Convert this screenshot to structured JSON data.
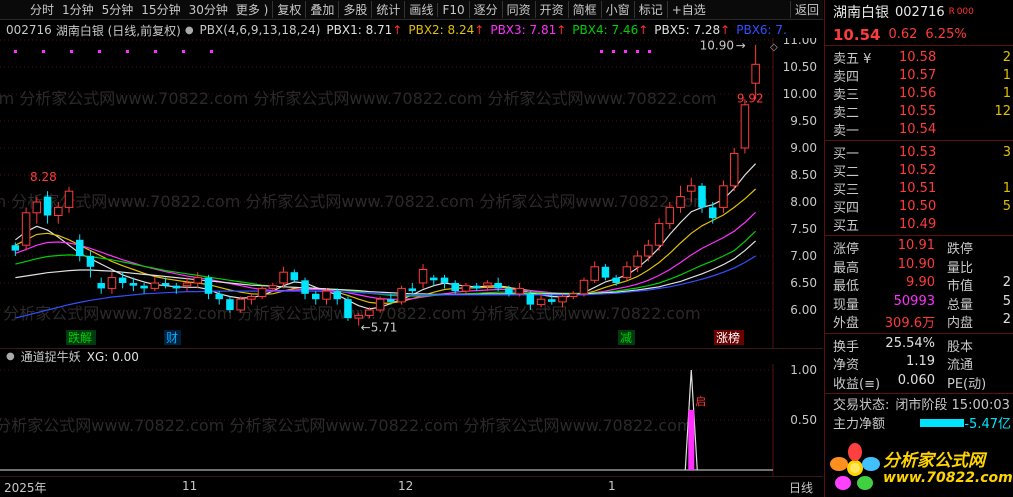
{
  "toolbar": {
    "periods": [
      "分时",
      "1分钟",
      "5分钟",
      "15分钟",
      "30分钟",
      "更多 )"
    ],
    "tools": [
      "复权",
      "叠加",
      "多股",
      "统计",
      "画线",
      "F10",
      "逐分",
      "同资",
      "开资",
      "简框",
      "小窗",
      "标记",
      "+自选",
      "返回"
    ]
  },
  "infobar": {
    "code": "002716",
    "name": "湖南白银 (日线,前复权)",
    "param": "PBX(4,6,9,13,18,24)",
    "pbx": [
      {
        "label": "PBX1: 8.71",
        "color": "#e0e0e0"
      },
      {
        "label": "PBX2: 8.24",
        "color": "#e0c000"
      },
      {
        "label": "PBX3: 7.81",
        "color": "#ff30ff"
      },
      {
        "label": "PBX4: 7.46",
        "color": "#00d000"
      },
      {
        "label": "PBX5: 7.28",
        "color": "#e0e0e0"
      },
      {
        "label": "PBX6: 7.",
        "color": "#3050ff"
      }
    ],
    "up_arrow": "↑"
  },
  "indicator": {
    "title": "通道捉牛妖",
    "xg": "XG: 0.00",
    "ticks": [
      "1.00",
      "0.50"
    ],
    "signal_label": "启"
  },
  "markers": {
    "high_label": "8.28",
    "low_label": "←5.71",
    "top_label": "10.90",
    "top_arrow": "→",
    "last_label": "9.92",
    "events": [
      "跌解",
      "财",
      "减",
      "涨榜"
    ]
  },
  "xaxis": {
    "labels": [
      "2025年",
      "11",
      "12",
      "1",
      "日线"
    ]
  },
  "colors": {
    "up": "#ff3b3b",
    "down": "#00e5ff",
    "bg": "#000000",
    "grid": "#4a1010"
  },
  "chart_data": {
    "type": "candlestick",
    "y_ticks": [
      "11.00",
      "10.50",
      "10.00",
      "9.50",
      "9.00",
      "8.50",
      "8.00",
      "7.50",
      "7.00",
      "6.50",
      "6.00"
    ],
    "ylim": [
      5.5,
      11.2
    ],
    "candles": [
      [
        7.2,
        7.1,
        7.25,
        7.0
      ],
      [
        7.2,
        7.8,
        7.9,
        7.1
      ],
      [
        7.8,
        8.0,
        8.1,
        7.6
      ],
      [
        8.1,
        7.75,
        8.2,
        7.6
      ],
      [
        7.75,
        7.9,
        8.0,
        7.6
      ],
      [
        7.9,
        8.2,
        8.28,
        7.8
      ],
      [
        7.3,
        7.0,
        7.4,
        6.9
      ],
      [
        7.0,
        6.8,
        7.1,
        6.6
      ],
      [
        6.5,
        6.4,
        6.6,
        6.3
      ],
      [
        6.4,
        6.6,
        6.7,
        6.3
      ],
      [
        6.6,
        6.5,
        6.7,
        6.4
      ],
      [
        6.5,
        6.45,
        6.6,
        6.35
      ],
      [
        6.45,
        6.4,
        6.5,
        6.3
      ],
      [
        6.4,
        6.5,
        6.6,
        6.35
      ],
      [
        6.5,
        6.45,
        6.6,
        6.4
      ],
      [
        6.45,
        6.4,
        6.5,
        6.3
      ],
      [
        6.45,
        6.5,
        6.6,
        6.35
      ],
      [
        6.5,
        6.6,
        6.7,
        6.4
      ],
      [
        6.6,
        6.3,
        6.65,
        6.2
      ],
      [
        6.3,
        6.2,
        6.35,
        6.1
      ],
      [
        6.2,
        6.0,
        6.25,
        5.95
      ],
      [
        6.0,
        6.2,
        6.25,
        5.95
      ],
      [
        6.2,
        6.25,
        6.3,
        6.1
      ],
      [
        6.25,
        6.4,
        6.45,
        6.2
      ],
      [
        6.4,
        6.45,
        6.5,
        6.35
      ],
      [
        6.5,
        6.7,
        6.8,
        6.4
      ],
      [
        6.7,
        6.55,
        6.75,
        6.5
      ],
      [
        6.55,
        6.3,
        6.6,
        6.2
      ],
      [
        6.3,
        6.2,
        6.35,
        6.1
      ],
      [
        6.2,
        6.35,
        6.4,
        6.1
      ],
      [
        6.35,
        6.2,
        6.4,
        6.1
      ],
      [
        6.2,
        5.85,
        6.25,
        5.8
      ],
      [
        5.85,
        5.9,
        5.95,
        5.71
      ],
      [
        5.9,
        6.0,
        6.05,
        5.85
      ],
      [
        6.0,
        6.2,
        6.25,
        5.95
      ],
      [
        6.2,
        6.15,
        6.3,
        6.1
      ],
      [
        6.15,
        6.4,
        6.45,
        6.1
      ],
      [
        6.4,
        6.35,
        6.5,
        6.3
      ],
      [
        6.5,
        6.75,
        6.85,
        6.4
      ],
      [
        6.6,
        6.55,
        6.65,
        6.45
      ],
      [
        6.6,
        6.5,
        6.65,
        6.4
      ],
      [
        6.5,
        6.35,
        6.55,
        6.3
      ],
      [
        6.35,
        6.45,
        6.5,
        6.3
      ],
      [
        6.45,
        6.4,
        6.5,
        6.35
      ],
      [
        6.45,
        6.5,
        6.55,
        6.35
      ],
      [
        6.5,
        6.4,
        6.6,
        6.35
      ],
      [
        6.4,
        6.3,
        6.45,
        6.25
      ],
      [
        6.3,
        6.4,
        6.5,
        6.25
      ],
      [
        6.3,
        6.1,
        6.35,
        6.0
      ],
      [
        6.1,
        6.2,
        6.3,
        6.05
      ],
      [
        6.2,
        6.15,
        6.3,
        6.1
      ],
      [
        6.15,
        6.25,
        6.3,
        6.05
      ],
      [
        6.25,
        6.3,
        6.35,
        6.2
      ],
      [
        6.3,
        6.55,
        6.6,
        6.25
      ],
      [
        6.55,
        6.8,
        6.9,
        6.5
      ],
      [
        6.8,
        6.6,
        6.85,
        6.55
      ],
      [
        6.6,
        6.5,
        6.65,
        6.45
      ],
      [
        6.6,
        6.8,
        6.9,
        6.55
      ],
      [
        6.8,
        7.0,
        7.1,
        6.7
      ],
      [
        7.0,
        7.2,
        7.3,
        6.9
      ],
      [
        7.2,
        7.6,
        7.7,
        7.1
      ],
      [
        7.6,
        7.9,
        8.0,
        7.5
      ],
      [
        7.9,
        8.1,
        8.3,
        7.8
      ],
      [
        8.2,
        8.3,
        8.45,
        8.0
      ],
      [
        8.3,
        7.9,
        8.35,
        7.8
      ],
      [
        7.9,
        7.7,
        8.0,
        7.6
      ],
      [
        7.9,
        8.3,
        8.4,
        7.8
      ],
      [
        8.3,
        8.9,
        9.0,
        8.2
      ],
      [
        9.0,
        9.8,
        9.9,
        8.9
      ],
      [
        10.2,
        10.55,
        10.91,
        9.9
      ]
    ],
    "ma_series": [
      {
        "color": "#e0e0e0",
        "values": [
          7.3,
          7.45,
          7.55,
          7.48,
          7.35,
          7.2,
          7.05,
          6.95,
          6.85,
          6.75,
          6.65,
          6.58,
          6.52,
          6.47,
          6.45,
          6.43,
          6.42,
          6.42,
          6.38,
          6.3,
          6.25,
          6.22,
          6.23,
          6.27,
          6.35,
          6.45,
          6.52,
          6.5,
          6.42,
          6.35,
          6.28,
          6.18,
          6.08,
          6.02,
          6.05,
          6.12,
          6.2,
          6.28,
          6.38,
          6.45,
          6.5,
          6.47,
          6.44,
          6.43,
          6.44,
          6.45,
          6.42,
          6.38,
          6.32,
          6.28,
          6.25,
          6.24,
          6.26,
          6.32,
          6.42,
          6.52,
          6.58,
          6.65,
          6.78,
          6.95,
          7.15,
          7.4,
          7.62,
          7.82,
          7.9,
          7.95,
          8.05,
          8.25,
          8.5,
          8.71
        ]
      },
      {
        "color": "#e0c000",
        "values": [
          7.2,
          7.3,
          7.4,
          7.42,
          7.38,
          7.3,
          7.2,
          7.1,
          7.0,
          6.9,
          6.82,
          6.75,
          6.68,
          6.62,
          6.58,
          6.55,
          6.52,
          6.5,
          6.47,
          6.42,
          6.37,
          6.33,
          6.3,
          6.29,
          6.3,
          6.35,
          6.4,
          6.42,
          6.4,
          6.37,
          6.33,
          6.27,
          6.2,
          6.14,
          6.12,
          6.13,
          6.16,
          6.21,
          6.27,
          6.33,
          6.38,
          6.4,
          6.41,
          6.41,
          6.42,
          6.42,
          6.41,
          6.39,
          6.36,
          6.33,
          6.3,
          6.28,
          6.28,
          6.3,
          6.35,
          6.42,
          6.48,
          6.54,
          6.62,
          6.74,
          6.88,
          7.05,
          7.24,
          7.42,
          7.56,
          7.66,
          7.76,
          7.9,
          8.06,
          8.24
        ]
      },
      {
        "color": "#ff30ff",
        "values": [
          7.05,
          7.12,
          7.2,
          7.25,
          7.26,
          7.24,
          7.2,
          7.14,
          7.07,
          7.0,
          6.93,
          6.87,
          6.81,
          6.76,
          6.71,
          6.67,
          6.63,
          6.6,
          6.57,
          6.53,
          6.49,
          6.45,
          6.41,
          6.38,
          6.36,
          6.36,
          6.37,
          6.38,
          6.38,
          6.37,
          6.35,
          6.32,
          6.28,
          6.24,
          6.21,
          6.2,
          6.2,
          6.21,
          6.24,
          6.27,
          6.3,
          6.33,
          6.35,
          6.36,
          6.37,
          6.38,
          6.38,
          6.37,
          6.36,
          6.34,
          6.32,
          6.31,
          6.3,
          6.3,
          6.32,
          6.35,
          6.39,
          6.43,
          6.48,
          6.55,
          6.64,
          6.75,
          6.88,
          7.02,
          7.14,
          7.24,
          7.34,
          7.46,
          7.62,
          7.81
        ]
      },
      {
        "color": "#00d000",
        "values": [
          6.85,
          6.9,
          6.95,
          6.99,
          7.01,
          7.02,
          7.01,
          6.99,
          6.96,
          6.93,
          6.89,
          6.85,
          6.81,
          6.77,
          6.73,
          6.7,
          6.67,
          6.64,
          6.61,
          6.58,
          6.55,
          6.52,
          6.49,
          6.46,
          6.44,
          6.43,
          6.42,
          6.41,
          6.4,
          6.39,
          6.38,
          6.36,
          6.34,
          6.31,
          6.29,
          6.27,
          6.26,
          6.26,
          6.26,
          6.27,
          6.28,
          6.29,
          6.3,
          6.31,
          6.32,
          6.33,
          6.33,
          6.33,
          6.33,
          6.32,
          6.31,
          6.31,
          6.31,
          6.31,
          6.32,
          6.33,
          6.35,
          6.38,
          6.41,
          6.45,
          6.5,
          6.57,
          6.65,
          6.74,
          6.83,
          6.91,
          7.0,
          7.1,
          7.27,
          7.46
        ]
      },
      {
        "color": "#e0e0e0",
        "values": [
          6.6,
          6.63,
          6.66,
          6.69,
          6.71,
          6.73,
          6.74,
          6.74,
          6.73,
          6.72,
          6.7,
          6.68,
          6.66,
          6.64,
          6.62,
          6.6,
          6.58,
          6.56,
          6.54,
          6.52,
          6.5,
          6.48,
          6.46,
          6.45,
          6.44,
          6.43,
          6.42,
          6.41,
          6.4,
          6.39,
          6.38,
          6.37,
          6.36,
          6.34,
          6.33,
          6.32,
          6.31,
          6.3,
          6.3,
          6.29,
          6.29,
          6.29,
          6.29,
          6.29,
          6.3,
          6.3,
          6.3,
          6.3,
          6.3,
          6.3,
          6.3,
          6.3,
          6.3,
          6.3,
          6.31,
          6.32,
          6.33,
          6.35,
          6.37,
          6.4,
          6.43,
          6.48,
          6.53,
          6.6,
          6.67,
          6.75,
          6.84,
          6.95,
          7.1,
          7.28
        ]
      },
      {
        "color": "#3050ff",
        "values": [
          5.85,
          5.9,
          5.95,
          6.0,
          6.05,
          6.1,
          6.14,
          6.18,
          6.21,
          6.24,
          6.26,
          6.28,
          6.3,
          6.31,
          6.32,
          6.33,
          6.34,
          6.34,
          6.35,
          6.35,
          6.35,
          6.35,
          6.35,
          6.35,
          6.35,
          6.35,
          6.35,
          6.35,
          6.35,
          6.34,
          6.34,
          6.33,
          6.32,
          6.31,
          6.3,
          6.29,
          6.28,
          6.28,
          6.28,
          6.28,
          6.28,
          6.28,
          6.28,
          6.28,
          6.28,
          6.28,
          6.28,
          6.28,
          6.28,
          6.28,
          6.28,
          6.28,
          6.28,
          6.28,
          6.29,
          6.3,
          6.31,
          6.33,
          6.35,
          6.37,
          6.4,
          6.43,
          6.47,
          6.52,
          6.57,
          6.63,
          6.7,
          6.78,
          6.88,
          7.0
        ]
      }
    ],
    "signal": {
      "index": 63,
      "value": 1.0
    }
  },
  "panel": {
    "name": "湖南白银",
    "code": "002716",
    "badge": "R 000",
    "price": "10.54",
    "change": "0.62",
    "pct": "6.25%",
    "sell": [
      {
        "label": "卖五 ¥",
        "price": "10.58",
        "vol": "2"
      },
      {
        "label": "卖四",
        "price": "10.57",
        "vol": "1"
      },
      {
        "label": "卖三",
        "price": "10.56",
        "vol": "1"
      },
      {
        "label": "卖二",
        "price": "10.55",
        "vol": "12"
      },
      {
        "label": "卖一",
        "price": "10.54",
        "vol": ""
      }
    ],
    "buy": [
      {
        "label": "买一",
        "price": "10.53",
        "vol": "3"
      },
      {
        "label": "买二",
        "price": "10.52",
        "vol": ""
      },
      {
        "label": "买三",
        "price": "10.51",
        "vol": "1"
      },
      {
        "label": "买四",
        "price": "10.50",
        "vol": "5"
      },
      {
        "label": "买五",
        "price": "10.49",
        "vol": ""
      }
    ],
    "stats1": [
      {
        "k1": "涨停",
        "v1": "10.91",
        "c1": "red",
        "k2": "跌停",
        "v2": ""
      },
      {
        "k1": "最高",
        "v1": "10.90",
        "c1": "red",
        "k2": "量比",
        "v2": ""
      },
      {
        "k1": "最低",
        "v1": "9.90",
        "c1": "red",
        "k2": "市值",
        "v2": "2"
      },
      {
        "k1": "现量",
        "v1": "50993",
        "c1": "mag",
        "k2": "总量",
        "v2": "5"
      },
      {
        "k1": "外盘",
        "v1": "309.6万",
        "c1": "red",
        "k2": "内盘",
        "v2": "2"
      }
    ],
    "stats2": [
      {
        "k1": "换手",
        "v1": "25.54%",
        "c1": "wht",
        "k2": "股本",
        "v2": ""
      },
      {
        "k1": "净资",
        "v1": "1.19",
        "c1": "wht",
        "k2": "流通",
        "v2": ""
      },
      {
        "k1": "收益(≡)",
        "v1": "0.060",
        "c1": "wht",
        "k2": "PE(动)",
        "v2": ""
      }
    ],
    "trade_label": "交易状态:",
    "trade_value": "闭市阶段 15:00:03",
    "mainflow_label": "主力净额",
    "mainflow_value": "-5.47亿",
    "logo_text": "分析家公式网",
    "logo_url": "www.70822.com"
  },
  "watermark": "com 分析家公式网www.70822.com 分析家公式网www.70822.com 分析家公式网www.70822.com"
}
